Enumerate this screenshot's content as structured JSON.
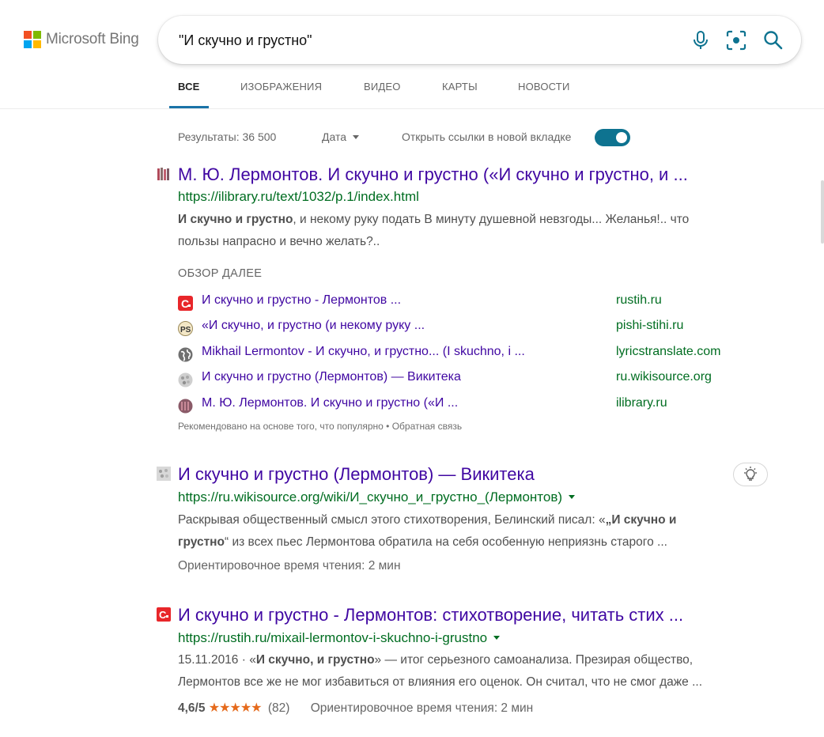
{
  "logo": {
    "text": "Microsoft Bing",
    "colors": [
      "#f25022",
      "#7fba00",
      "#00a4ef",
      "#ffb900"
    ]
  },
  "search": {
    "query": "\"И скучно и грустно\"",
    "icons": [
      "microphone-icon",
      "visual-search-icon",
      "search-icon"
    ],
    "accent": "#0e7390"
  },
  "tabs": [
    {
      "label": "ВСЕ",
      "active": true
    },
    {
      "label": "ИЗОБРАЖЕНИЯ",
      "active": false
    },
    {
      "label": "ВИДЕО",
      "active": false
    },
    {
      "label": "КАРТЫ",
      "active": false
    },
    {
      "label": "НОВОСТИ",
      "active": false
    }
  ],
  "toolbar": {
    "results_count": "Результаты: 36 500",
    "date_filter": "Дата",
    "open_new_tab_label": "Открыть ссылки в новой вкладке",
    "open_new_tab_enabled": true
  },
  "results": [
    {
      "title": "М. Ю. Лермонтов. И скучно и грустно («И скучно и грустно, и ...",
      "url": "https://ilibrary.ru/text/1032/p.1/index.html",
      "snippet_bold": "И скучно и грустно",
      "snippet_line1_rest": ", и некому руку подать В минуту душевной невзгоды... Желанья!.. что",
      "snippet_line2": "пользы напрасно и вечно желать?..",
      "favicon": "books-icon",
      "deeplinks_heading": "ОБЗОР ДАЛЕЕ",
      "deeplinks": [
        {
          "title": "И скучно и грустно - Лермонтов ...",
          "site": "rustih.ru",
          "icon": "rustih-icon"
        },
        {
          "title": "«И скучно, и грустно (и некому руку ...",
          "site": "pishi-stihi.ru",
          "icon": "pishi-stihi-icon"
        },
        {
          "title": "Mikhail Lermontov - И скучно, и грустно... (I skuchno, i ...",
          "site": "lyricstranslate.com",
          "icon": "globe-icon"
        },
        {
          "title": "И скучно и грустно (Лермонтов) — Викитека",
          "site": "ru.wikisource.org",
          "icon": "wikisource-icon"
        },
        {
          "title": "М. Ю. Лермонтов. И скучно и грустно («И ...",
          "site": "ilibrary.ru",
          "icon": "books-icon"
        }
      ],
      "deeplinks_footer": "Рекомендовано на основе того, что популярно • Обратная связь"
    },
    {
      "title": "И скучно и грустно (Лермонтов) — Викитека",
      "url": "https://ru.wikisource.org/wiki/И_скучно_и_грустно_(Лермонтов)",
      "snippet_line1_pre": "Раскрывая общественный смысл этого стихотворения, Белинский писал: «",
      "snippet_line1_bold": "„И скучно и",
      "snippet_line2_bold": "грустно",
      "snippet_line2_rest": "“ из всех пьес Лермонтова обратила на себя особенную неприязнь старого ...",
      "meta": "Ориентировочное время чтения: 2 мин",
      "favicon": "wikisource-icon"
    },
    {
      "title": "И скучно и грустно - Лермонтов: стихотворение, читать стих ...",
      "url": "https://rustih.ru/mixail-lermontov-i-skuchno-i-grustno",
      "snippet_line1_pre": "15.11.2016 · «",
      "snippet_line1_bold": "И скучно, и грустно",
      "snippet_line1_rest": "» — итог серьезного самоанализа. Презирая общество,",
      "snippet_line2": "Лермонтов все же не мог избавиться от влияния его оценок. Он считал, что не смог даже ...",
      "rating": "4,6/5",
      "stars": "★★★★★",
      "rating_value": 4.6,
      "reviews": "(82)",
      "meta": "Ориентировочное время чтения: 2 мин",
      "favicon": "rustih-icon"
    }
  ]
}
